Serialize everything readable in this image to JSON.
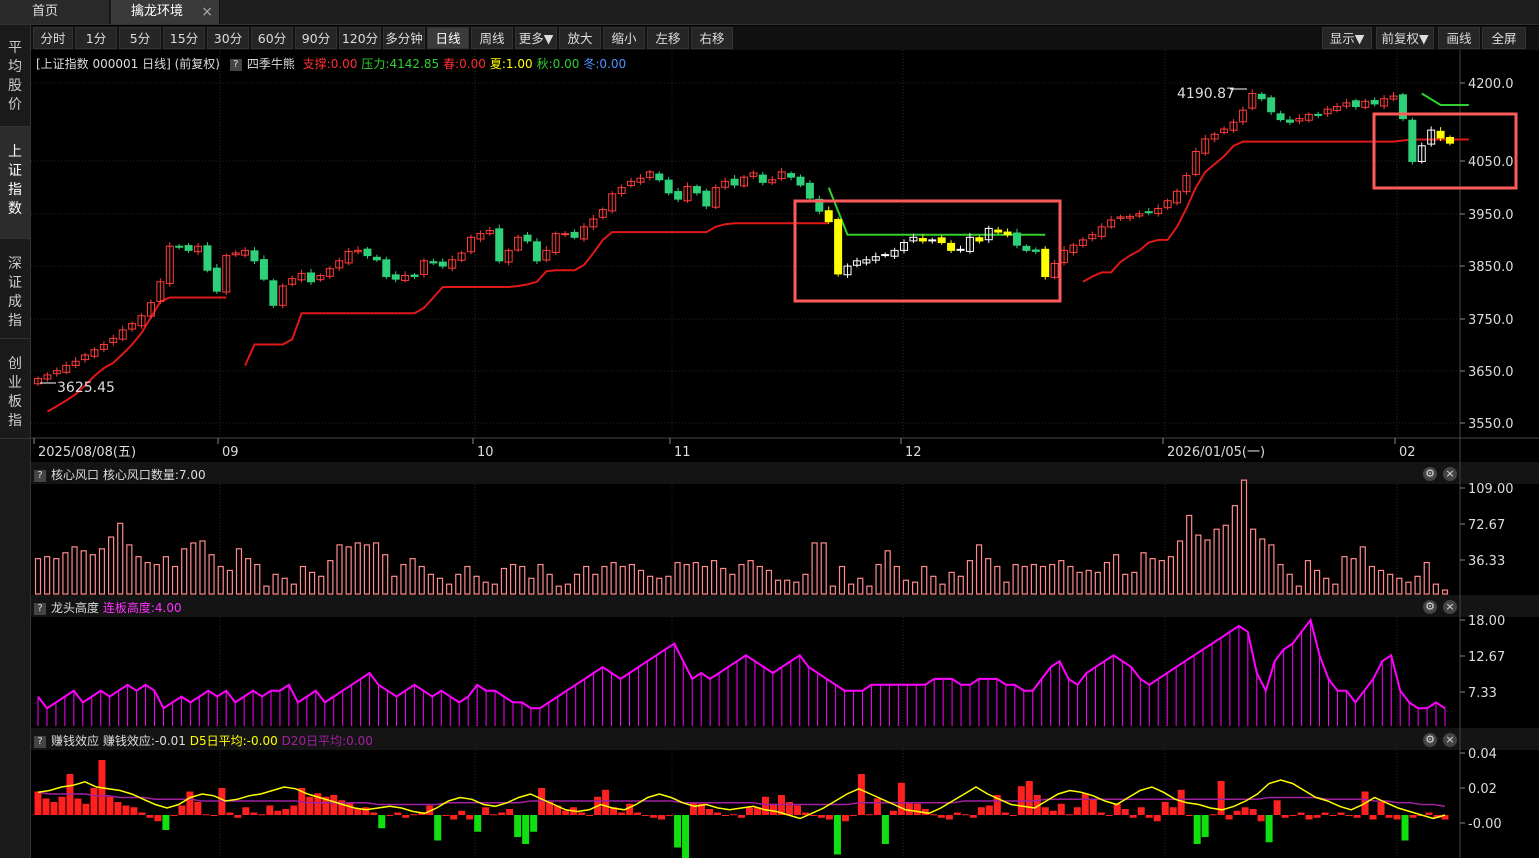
{
  "tabs": [
    {
      "label": "首页"
    },
    {
      "label": "擒龙环境"
    }
  ],
  "sidebar": [
    {
      "label": "平均股价"
    },
    {
      "label": "上证指数"
    },
    {
      "label": "深证成指"
    },
    {
      "label": "创业板指"
    }
  ],
  "toolbar": {
    "periods": [
      "分时",
      "1分",
      "5分",
      "15分",
      "30分",
      "60分",
      "90分",
      "120分",
      "多分钟",
      "日线",
      "周线",
      "更多▼",
      "放大",
      "缩小",
      "左移",
      "右移"
    ],
    "active_period": "日线",
    "right": [
      "显示▼",
      "前复权▼",
      "画线",
      "全屏"
    ]
  },
  "main_chart": {
    "title": "[上证指数 000001 日线] (前复权)",
    "indicator": "四季牛熊",
    "params": [
      {
        "text": "支撑:0.00",
        "color": "#ff3030"
      },
      {
        "text": "压力:4142.85",
        "color": "#30d030"
      },
      {
        "text": "春:0.00",
        "color": "#ff3030"
      },
      {
        "text": "夏:1.00",
        "color": "#ffff00"
      },
      {
        "text": "秋:0.00",
        "color": "#30d030"
      },
      {
        "text": "冬:0.00",
        "color": "#5090ff"
      }
    ],
    "y_ticks": [
      "4200.0",
      "4050.0",
      "3950.0",
      "3850.0",
      "3750.0",
      "3650.0",
      "3550.0"
    ],
    "x_ticks": [
      "2025/08/08(五)",
      "09",
      "10",
      "11",
      "12",
      "2026/01/05(一)",
      "02"
    ],
    "annotation_high": "4190.87",
    "annotation_low": "3625.45"
  },
  "panel1": {
    "name": "核心风口",
    "param": "核心风口数量:7.00",
    "y_ticks": [
      "109.00",
      "72.67",
      "36.33"
    ]
  },
  "panel2": {
    "name": "龙头高度",
    "param": "连板高度:4.00",
    "y_ticks": [
      "18.00",
      "12.67",
      "7.33"
    ]
  },
  "panel3": {
    "name": "赚钱效应",
    "param": "赚钱效应:-0.01",
    "d5": "D5日平均:-0.00",
    "d20": "D20日平均:0.00",
    "y_ticks": [
      "0.04",
      "0.02",
      "-0.00"
    ]
  },
  "colors": {
    "up": "#ff3c3c",
    "down": "#2fd07a",
    "yellow": "#ffff00",
    "support": "#e01818",
    "resist": "#30d030",
    "magenta": "#ff00ff",
    "highlight": "#ff5a5a"
  },
  "chart_data": [
    {
      "type": "candlestick",
      "title": "[上证指数 000001 日线] (前复权)",
      "closes": [
        3635,
        3642,
        3650,
        3660,
        3668,
        3680,
        3690,
        3700,
        3712,
        3728,
        3740,
        3755,
        3780,
        3820,
        3888,
        3886,
        3880,
        3888,
        3842,
        3802,
        3870,
        3875,
        3880,
        3860,
        3825,
        3775,
        3812,
        3826,
        3836,
        3820,
        3832,
        3845,
        3860,
        3878,
        3880,
        3870,
        3862,
        3830,
        3825,
        3832,
        3830,
        3860,
        3856,
        3850,
        3862,
        3875,
        3905,
        3912,
        3918,
        3860,
        3880,
        3905,
        3898,
        3860,
        3880,
        3912,
        3912,
        3905,
        3925,
        3940,
        3958,
        3988,
        4000,
        4012,
        4018,
        4030,
        4015,
        3990,
        3978,
        4002,
        3990,
        3965,
        4000,
        4012,
        4005,
        4020,
        4028,
        4010,
        4015,
        4030,
        4020,
        4005,
        3980,
        3955,
        3935,
        3835,
        3850,
        3860,
        3862,
        3868,
        3872,
        3880,
        3895,
        3905,
        3898,
        3900,
        3895,
        3880,
        3882,
        3905,
        3898,
        3922,
        3915,
        3910,
        3890,
        3880,
        3878,
        3830,
        3855,
        3880,
        3890,
        3900,
        3910,
        3925,
        3938,
        3944,
        3945,
        3950,
        3952,
        3960,
        3975,
        3993,
        4023,
        4069,
        4093,
        4102,
        4112,
        4125,
        4148,
        4180,
        4170,
        4145,
        4130,
        4125,
        4132,
        4140,
        4138,
        4150,
        4155,
        4162,
        4155,
        4165,
        4160,
        4170,
        4175,
        4132,
        4050,
        4080,
        4110,
        4095,
        4085
      ],
      "support": [
        null,
        3572,
        3582,
        3593,
        3605,
        3622,
        3640,
        3655,
        3665,
        3682,
        3700,
        3722,
        3752,
        3782,
        3790,
        3790,
        3790,
        3790,
        3790,
        3790,
        3790,
        null,
        3660,
        3700,
        3700,
        3700,
        3700,
        3710,
        3760,
        3760,
        3760,
        3760,
        3760,
        3760,
        3760,
        3760,
        3760,
        3760,
        3760,
        3760,
        3760,
        3770,
        3790,
        3810,
        3810,
        3810,
        3810,
        3810,
        3810,
        3810,
        3810,
        3812,
        3815,
        3820,
        3840,
        3842,
        3842,
        3842,
        3852,
        3875,
        3900,
        3915,
        3915,
        3915,
        3915,
        3915,
        3915,
        3915,
        3915,
        3915,
        3915,
        3915,
        3925,
        3930,
        3932,
        3932,
        3932,
        3932,
        3932,
        3932,
        3932,
        3932,
        3932,
        3932,
        3932,
        null,
        null,
        null,
        null,
        null,
        null,
        null,
        null,
        null,
        null,
        null,
        null,
        null,
        null,
        null,
        null,
        null,
        null,
        null,
        null,
        null,
        null,
        null,
        null,
        null,
        null,
        3820,
        3830,
        3838,
        3838,
        3858,
        3870,
        3880,
        3895,
        3900,
        3900,
        3925,
        3960,
        4000,
        4030,
        4045,
        4060,
        4080,
        4088,
        4088,
        4088,
        4088,
        4088,
        4088,
        4088,
        4088,
        4088,
        4088,
        4088,
        4088,
        4088,
        4088,
        4088,
        4088,
        4088,
        4090,
        4092,
        4092,
        4092,
        4092,
        4092,
        4092,
        4092
      ],
      "resistance_segments": [
        {
          "from": 84,
          "to": 107,
          "start": 4000,
          "level": 3910
        },
        {
          "from": 147,
          "to": 152,
          "start": 4180,
          "level": 4158
        }
      ],
      "ylim": [
        3550,
        4200
      ]
    },
    {
      "type": "bar",
      "name": "核心风口",
      "param": "核心风口数量:7.00",
      "ylim": [
        0,
        109
      ],
      "values": [
        36,
        38,
        36,
        42,
        48,
        44,
        40,
        46,
        58,
        72,
        50,
        38,
        32,
        30,
        38,
        28,
        46,
        52,
        54,
        40,
        28,
        24,
        46,
        36,
        30,
        8,
        20,
        16,
        10,
        28,
        22,
        18,
        34,
        50,
        48,
        52,
        50,
        52,
        40,
        18,
        30,
        36,
        28,
        20,
        16,
        10,
        20,
        28,
        18,
        12,
        10,
        26,
        30,
        28,
        16,
        30,
        20,
        8,
        10,
        20,
        28,
        20,
        28,
        32,
        28,
        30,
        24,
        18,
        16,
        18,
        32,
        30,
        32,
        28,
        34,
        26,
        20,
        30,
        34,
        28,
        24,
        14,
        14,
        12,
        20,
        52,
        52,
        8,
        28,
        10,
        16,
        8,
        30,
        44,
        28,
        14,
        12,
        28,
        18,
        10,
        22,
        18,
        34,
        50,
        36,
        28,
        12,
        30,
        28,
        30,
        28,
        30,
        34,
        28,
        22,
        24,
        22,
        32,
        40,
        20,
        22,
        42,
        36,
        34,
        38,
        54,
        80,
        60,
        55,
        66,
        70,
        90,
        116,
        66,
        56,
        50,
        30,
        20,
        8,
        34,
        24,
        16,
        10,
        38,
        36,
        48,
        28,
        24,
        20,
        16,
        12,
        18,
        32,
        10,
        4
      ]
    },
    {
      "type": "line",
      "name": "龙头高度",
      "param": "连板高度:4.00",
      "ylim": [
        0,
        18
      ],
      "values": [
        5,
        3,
        4,
        5,
        6,
        4,
        5,
        6,
        5,
        6,
        7,
        6,
        7,
        6,
        3,
        4,
        5,
        4,
        5,
        6,
        5,
        6,
        4,
        5,
        6,
        5,
        6,
        6,
        7,
        4,
        5,
        6,
        4,
        5,
        6,
        7,
        8,
        9,
        7,
        6,
        5,
        6,
        7,
        6,
        5,
        6,
        5,
        4,
        5,
        7,
        6,
        6,
        5,
        4,
        4,
        3,
        3,
        4,
        5,
        6,
        7,
        8,
        9,
        10,
        9,
        8,
        9,
        10,
        11,
        12,
        13,
        14,
        11,
        8,
        9,
        8,
        9,
        10,
        11,
        12,
        11,
        10,
        9,
        10,
        11,
        12,
        10,
        9,
        8,
        7,
        6,
        6,
        6,
        7,
        7,
        7,
        7,
        7,
        7,
        7,
        8,
        8,
        8,
        7,
        7,
        8,
        8,
        8,
        7,
        7,
        6,
        6,
        8,
        10,
        11,
        8,
        7,
        9,
        10,
        11,
        12,
        11,
        10,
        8,
        7,
        8,
        9,
        10,
        11,
        12,
        13,
        14,
        15,
        16,
        17,
        16,
        9,
        6,
        11,
        13,
        14,
        16,
        18,
        12,
        8,
        6,
        6,
        4,
        6,
        8,
        11,
        12,
        6,
        4,
        3,
        3,
        4,
        3
      ]
    },
    {
      "type": "bar",
      "name": "赚钱效应",
      "param": "赚钱效应:-0.01",
      "ylim": [
        -0.015,
        0.04
      ],
      "values": [
        0.018,
        0.014,
        0.012,
        0.015,
        0.028,
        0.014,
        0.011,
        0.02,
        0.036,
        0.015,
        0.012,
        0.01,
        0.009,
        0.006,
        0.003,
        0.001,
        -0.004,
        0.004,
        0.01,
        0.018,
        0.012,
        0.005,
        0.004,
        0.02,
        0.006,
        0.003,
        0.009,
        0.006,
        0.005,
        0.01,
        0.007,
        0.008,
        0.01,
        0.02,
        0.015,
        0.017,
        0.015,
        0.016,
        0.013,
        0.012,
        0.008,
        0.009,
        0.006,
        -0.003,
        0.004,
        0.006,
        0.003,
        0.005,
        0.006,
        0.01,
        -0.01,
        0.004,
        0.002,
        0.007,
        0.002,
        -0.005,
        0.009,
        0.005,
        0.006,
        0.008,
        -0.008,
        -0.012,
        -0.005,
        0.02,
        0.012,
        0.01,
        0.007,
        0.009,
        0.006,
        0.004,
        0.015,
        0.019,
        0.009,
        0.006,
        0.011,
        0.006,
        0.004,
        0.003,
        0.002,
        0.004,
        -0.014,
        -0.02,
        0.012,
        0.011,
        0.008,
        0.006,
        0.004,
        0.005,
        0.003,
        0.009,
        0.009,
        0.015,
        0.011,
        0.016,
        0.012,
        0.01,
        0.006,
        0.004,
        0.003,
        0.002,
        -0.018,
        0.001,
        0.004,
        0.028,
        0.005,
        0.014,
        -0.012,
        0.007,
        0.023,
        0.012,
        0.011,
        0.008,
        0.005,
        0.003,
        0.002,
        0.006,
        0.005,
        0.003,
        0.009,
        0.01,
        0.016,
        0.006,
        0.004,
        0.021,
        0.024,
        0.016,
        0.009,
        0.007,
        0.011,
        0.005,
        0.009,
        0.017,
        0.014,
        0.006,
        0.004,
        0.011,
        0.008,
        0.003,
        0.009,
        0.003,
        0.001,
        0.012,
        0.009,
        0.019,
        0.004,
        -0.012,
        -0.008,
        0.005,
        0.024,
        0.002,
        0.007,
        0.009,
        0.008,
        0.001,
        -0.011,
        0.013,
        0.003,
        0.004,
        0.006,
        0.002,
        0.003,
        0.006,
        0.004,
        0.006,
        0.004,
        0.003,
        0.018,
        0.002,
        0.012,
        0.003,
        0.002,
        -0.01,
        0.003,
        0.004,
        0.006,
        0.003,
        0.002
      ],
      "d5": [
        0.013,
        0.014,
        0.016,
        0.017,
        0.019,
        0.016,
        0.015,
        0.014,
        0.012,
        0.009,
        0.006,
        0.004,
        0.006,
        0.01,
        0.012,
        0.011,
        0.008,
        0.009,
        0.011,
        0.012,
        0.014,
        0.016,
        0.015,
        0.012,
        0.01,
        0.008,
        0.006,
        0.004,
        0.003,
        0.004,
        0.005,
        0.004,
        0.002,
        0.001,
        0.004,
        0.008,
        0.01,
        0.009,
        0.006,
        0.005,
        0.007,
        0.01,
        0.012,
        0.009,
        0.006,
        0.003,
        0.002,
        0.003,
        0.006,
        0.004,
        0.003,
        0.006,
        0.01,
        0.012,
        0.01,
        0.007,
        0.005,
        0.006,
        0.004,
        0.003,
        0.004,
        0.005,
        0.003,
        0.002,
        0.0,
        -0.002,
        0.001,
        0.004,
        0.008,
        0.012,
        0.015,
        0.012,
        0.009,
        0.006,
        0.003,
        0.002,
        0.001,
        0.004,
        0.008,
        0.012,
        0.016,
        0.012,
        0.009,
        0.006,
        0.005,
        0.004,
        0.008,
        0.012,
        0.014,
        0.013,
        0.011,
        0.008,
        0.006,
        0.01,
        0.014,
        0.016,
        0.013,
        0.009,
        0.007,
        0.006,
        0.004,
        0.003,
        0.005,
        0.008,
        0.012,
        0.018,
        0.02,
        0.018,
        0.014,
        0.01,
        0.008,
        0.005,
        0.003,
        0.006,
        0.01,
        0.007,
        0.004,
        0.002,
        0.0,
        -0.002,
        0.0
      ],
      "d20": [
        0.013,
        0.012,
        0.012,
        0.012,
        0.012,
        0.011,
        0.011,
        0.01,
        0.01,
        0.01,
        0.009,
        0.009,
        0.009,
        0.009,
        0.008,
        0.008,
        0.008,
        0.008,
        0.008,
        0.008,
        0.008,
        0.008,
        0.008,
        0.007,
        0.007,
        0.007,
        0.007,
        0.007,
        0.007,
        0.006,
        0.006,
        0.006,
        0.006,
        0.006,
        0.006,
        0.007,
        0.007,
        0.007,
        0.007,
        0.007,
        0.007,
        0.007,
        0.008,
        0.008,
        0.008,
        0.008,
        0.008,
        0.008,
        0.008,
        0.008,
        0.008,
        0.008,
        0.008,
        0.008,
        0.008,
        0.007,
        0.007,
        0.007,
        0.007,
        0.007,
        0.007,
        0.007,
        0.006,
        0.006,
        0.006,
        0.006,
        0.006,
        0.006,
        0.006,
        0.006,
        0.007,
        0.007,
        0.007,
        0.007,
        0.007,
        0.007,
        0.007,
        0.007,
        0.007,
        0.008,
        0.008,
        0.008,
        0.008,
        0.008,
        0.008,
        0.008,
        0.009,
        0.009,
        0.009,
        0.009,
        0.009,
        0.009,
        0.009,
        0.009,
        0.009,
        0.009,
        0.009,
        0.009,
        0.009,
        0.009,
        0.009,
        0.009,
        0.009,
        0.009,
        0.009,
        0.01,
        0.01,
        0.01,
        0.01,
        0.01,
        0.009,
        0.009,
        0.009,
        0.009,
        0.008,
        0.008,
        0.007,
        0.007,
        0.006,
        0.006,
        0.005
      ]
    }
  ]
}
